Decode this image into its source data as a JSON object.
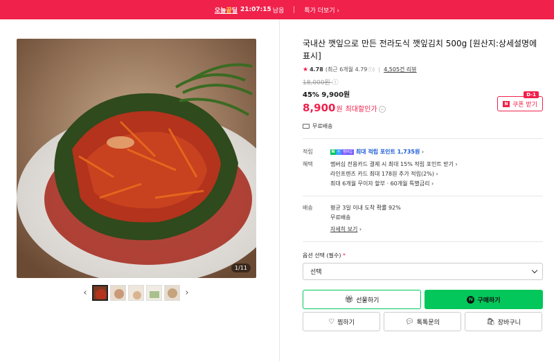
{
  "banner": {
    "brand_prefix": "오늘",
    "brand_highlight": "끝",
    "brand_suffix": "딜",
    "countdown": "21:07:15",
    "countdown_suffix": "남음",
    "link_label": "특가 더보기"
  },
  "gallery": {
    "counter": "1/11",
    "thumbnail_count": 5,
    "active_index": 0
  },
  "product": {
    "title": "국내산 깻잎으로 만든 전라도식 깻잎김치 500g [원산지:상세설명에 표시]",
    "rating": "4.78",
    "recent_rating": "(최근 6개월 4.79",
    "reviews": "4,505건 리뷰",
    "original_price": "18,000원",
    "discount_pct": "45%",
    "sale_price": "9,900원",
    "max_price": "8,900",
    "max_price_won": "원",
    "max_price_label": "최대할인가",
    "coupon_label": "쿠폰 받기",
    "coupon_badge": "D-1",
    "shipping_free": "무료배송"
  },
  "benefits": {
    "points_label": "적립",
    "points_text": "최대 적립 포인트 1,735원",
    "membership_badge": "멤버십",
    "benefit_label": "혜택",
    "benefit_lines": [
      "멤버십 전용카드 결제 시 최대 15% 적립 포인트 받기",
      "라인프렌즈 카드 최대 178원 추가 적립(2%)",
      "최대 6개월 무이자 할부 · 60개월 특별금리"
    ]
  },
  "delivery": {
    "label": "배송",
    "arrival": "평균 3일 이내 도착 확률 92%",
    "fee": "무료배송",
    "detail_link": "자세히 보기"
  },
  "options": {
    "label": "옵션 선택 (필수)",
    "required_mark": "*",
    "select_value": "선택"
  },
  "actions": {
    "gift": "선물하기",
    "buy": "구매하기",
    "wish": "찜하기",
    "talk": "톡톡문의",
    "cart": "장바구니"
  },
  "colors": {
    "accent": "#f0214b",
    "naver_green": "#03c75a"
  }
}
